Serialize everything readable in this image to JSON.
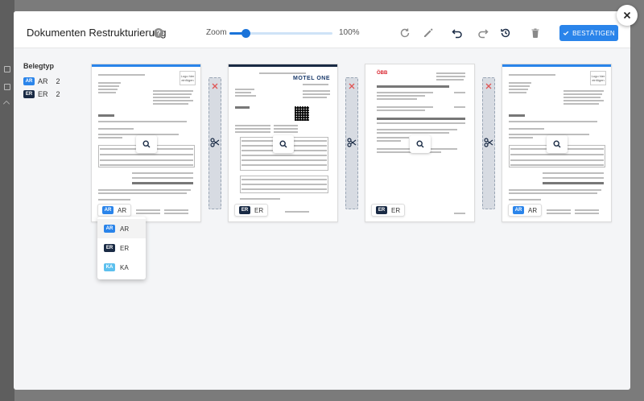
{
  "colors": {
    "accent": "#2a84ea",
    "badge_ar": "#2a84ea",
    "badge_er": "#1a2b45",
    "badge_ka": "#5cc0ee",
    "split_x": "#e05555"
  },
  "header": {
    "title": "Dokumenten Restrukturierung",
    "help_icon": "question-circle-icon",
    "zoom_label": "Zoom",
    "zoom_value": "100%",
    "zoom_fraction": 0.16,
    "toolbar_icons": [
      "rotate-icon",
      "edit-icon",
      "undo-icon",
      "redo-icon",
      "history-icon",
      "trash-icon"
    ],
    "confirm_label": "BESTÄTIGEN"
  },
  "sidebar": {
    "heading": "Belegtyp",
    "types": [
      {
        "badge": "AR",
        "label": "AR",
        "count": "2"
      },
      {
        "badge": "ER",
        "label": "ER",
        "count": "2"
      }
    ]
  },
  "documents": [
    {
      "badge": "AR",
      "label": "AR",
      "logo_text": "Logo hier einfügen"
    },
    {
      "badge": "ER",
      "label": "ER",
      "brand": "MOTEL ONE"
    },
    {
      "badge": "ER",
      "label": "ER",
      "brand": "ÖBB"
    },
    {
      "badge": "AR",
      "label": "AR",
      "logo_text": "Logo hier einfügen"
    }
  ],
  "dropdown": {
    "options": [
      {
        "badge": "AR",
        "label": "AR"
      },
      {
        "badge": "ER",
        "label": "ER"
      },
      {
        "badge": "KA",
        "label": "KA"
      }
    ]
  }
}
